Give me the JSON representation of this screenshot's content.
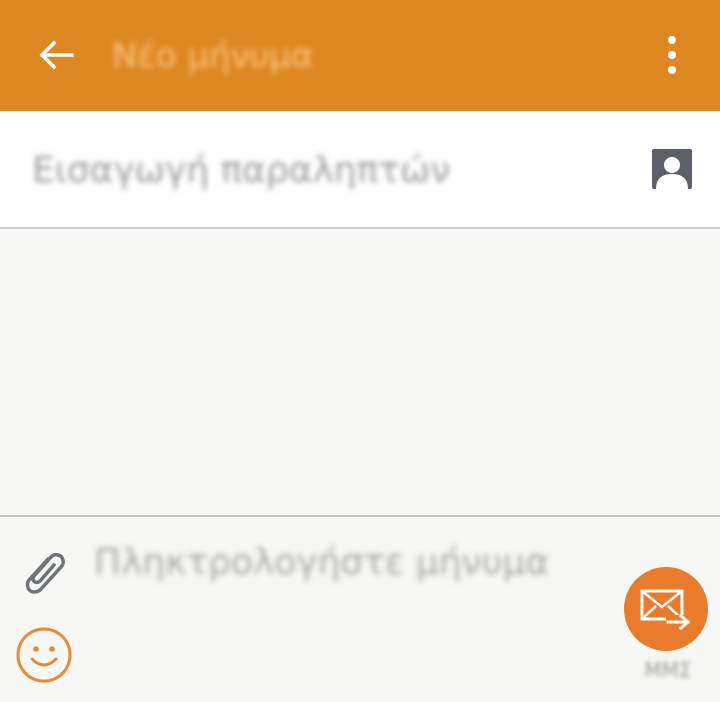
{
  "header": {
    "title": "Νέο μήνυμα",
    "back_icon": "arrow-left-icon",
    "menu_icon": "more-vertical-icon"
  },
  "recipients": {
    "placeholder": "Εισαγωγή παραληπτών",
    "contact_icon": "contact-person-icon"
  },
  "composer": {
    "placeholder": "Πληκτρολογήστε μήνυμα",
    "attach_icon": "paperclip-icon",
    "emoji_icon": "smiley-icon",
    "send_icon": "send-mail-icon",
    "send_label": "ΜΜΣ"
  },
  "colors": {
    "accent": "#de8823",
    "send_button": "#ea7b2c"
  }
}
